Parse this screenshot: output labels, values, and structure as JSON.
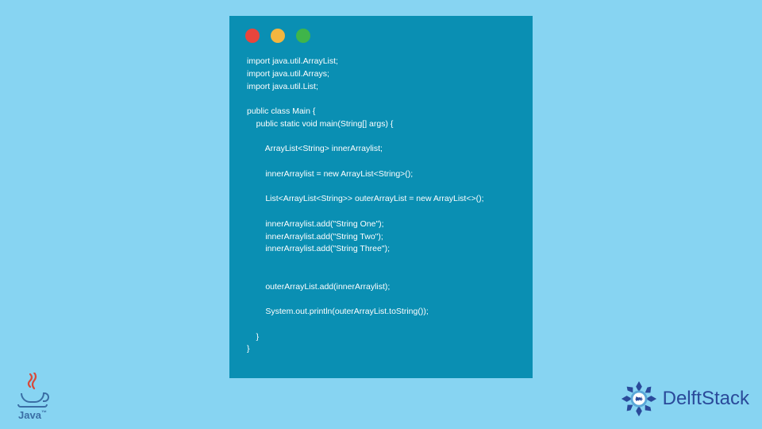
{
  "code_lines": "import java.util.ArrayList;\nimport java.util.Arrays;\nimport java.util.List;\n\npublic class Main {\n    public static void main(String[] args) {\n\n        ArrayList<String> innerArraylist;\n\n        innerArraylist = new ArrayList<String>();\n\n        List<ArrayList<String>> outerArrayList = new ArrayList<>();\n\n        innerArraylist.add(\"String One\");\n        innerArraylist.add(\"String Two\");\n        innerArraylist.add(\"String Three\");\n\n\n        outerArrayList.add(innerArraylist);\n\n        System.out.println(outerArrayList.toString());\n\n    }\n}",
  "dots": {
    "red": "#e8453c",
    "yellow": "#f3b63f",
    "green": "#3fb54a"
  },
  "java_label": "Java",
  "delft_label": "DelftStack"
}
